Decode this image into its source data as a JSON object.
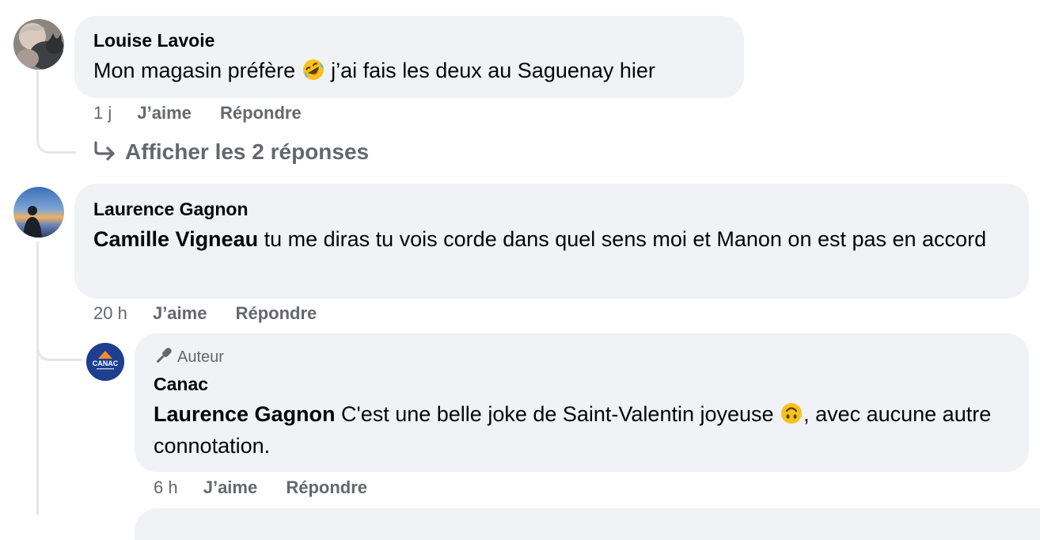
{
  "comments": [
    {
      "author": "Louise Lavoie",
      "text_before": "Mon magasin préfère",
      "text_after": " j’ai fais les deux au Saguenay hier",
      "emoji": "rolling-on-floor-laughing-emoji",
      "time": "1 j",
      "like_label": "J’aime",
      "reply_label": "Répondre",
      "view_replies_label": "Afficher les 2 réponses"
    },
    {
      "author": "Laurence Gagnon",
      "mention": "Camille Vigneau",
      "text": " tu me diras tu vois corde dans quel sens moi et Manon on est pas en accord",
      "time": "20 h",
      "like_label": "J’aime",
      "reply_label": "Répondre"
    }
  ],
  "reply": {
    "badge_label": "Auteur",
    "badge_icon": "microphone-icon",
    "author": "Canac",
    "avatar_text": "CANAC",
    "mention": "Laurence Gagnon",
    "text_before": " C'est une belle joke de Saint-Valentin joyeuse ",
    "emoji": "upside-down-face-emoji",
    "text_after": ", avec aucune autre connotation.",
    "time": "6 h",
    "like_label": "J’aime",
    "reply_label": "Répondre"
  },
  "colors": {
    "bubble_bg": "#f0f2f5",
    "meta_text": "#65676b",
    "canac_blue": "#1d3f8f",
    "canac_orange": "#f28c28"
  }
}
